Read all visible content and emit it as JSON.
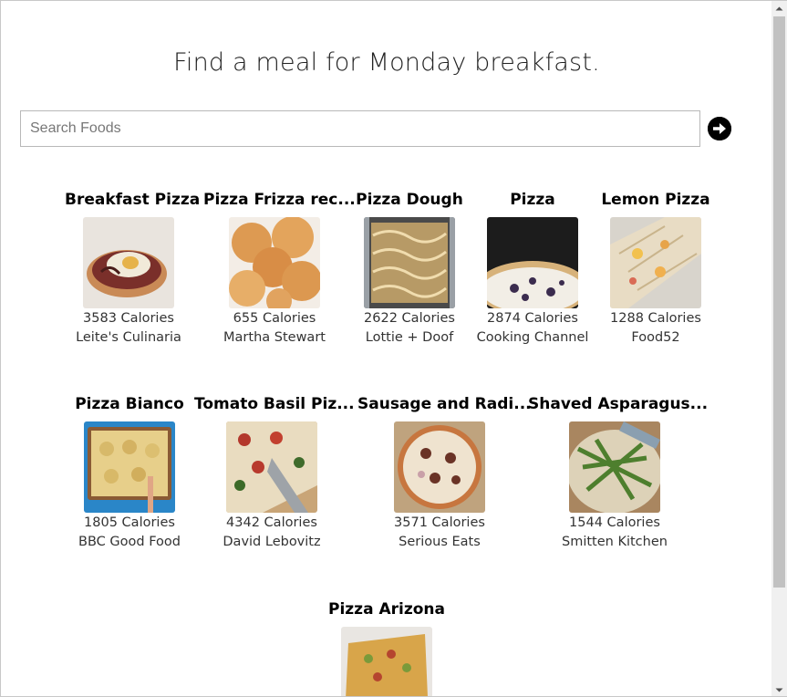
{
  "page": {
    "title": "Find a meal for Monday breakfast."
  },
  "search": {
    "placeholder": "Search Foods",
    "value": "",
    "submit_icon": "arrow-right-circle-icon"
  },
  "meals": [
    {
      "title": "Breakfast Pizza",
      "calories": "3583 Calories",
      "source": "Leite's Culinaria"
    },
    {
      "title": "Pizza Frizza rec...",
      "calories": "655 Calories",
      "source": "Martha Stewart"
    },
    {
      "title": "Pizza Dough",
      "calories": "2622 Calories",
      "source": "Lottie + Doof"
    },
    {
      "title": "Pizza",
      "calories": "2874 Calories",
      "source": "Cooking Channel"
    },
    {
      "title": "Lemon Pizza",
      "calories": "1288 Calories",
      "source": "Food52"
    },
    {
      "title": "Pizza Bianco",
      "calories": "1805 Calories",
      "source": "BBC Good Food"
    },
    {
      "title": "Tomato Basil Piz...",
      "calories": "4342 Calories",
      "source": "David Lebovitz"
    },
    {
      "title": "Sausage and Radi...",
      "calories": "3571 Calories",
      "source": "Serious Eats"
    },
    {
      "title": "Shaved Asparagus...",
      "calories": "1544 Calories",
      "source": "Smitten Kitchen"
    },
    {
      "title": "Pizza Arizona",
      "calories": "",
      "source": ""
    }
  ],
  "colors": {
    "accent": "#000000",
    "text": "#333333"
  }
}
